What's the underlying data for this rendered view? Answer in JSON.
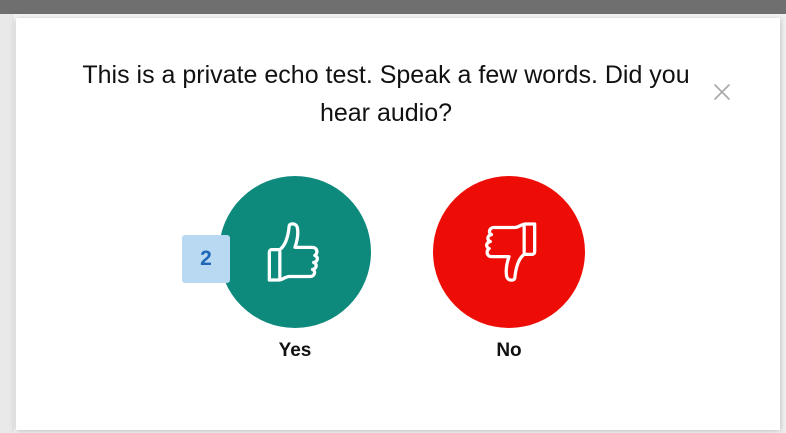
{
  "dialog": {
    "question": "This is a private echo test. Speak a few words. Did you hear audio?",
    "close_icon": "close-icon"
  },
  "choices": {
    "yes": {
      "label": "Yes",
      "icon": "thumbs-up-icon",
      "color": "#0e8a7d",
      "shortcut_badge": "2"
    },
    "no": {
      "label": "No",
      "icon": "thumbs-down-icon",
      "color": "#ee0c06"
    }
  }
}
